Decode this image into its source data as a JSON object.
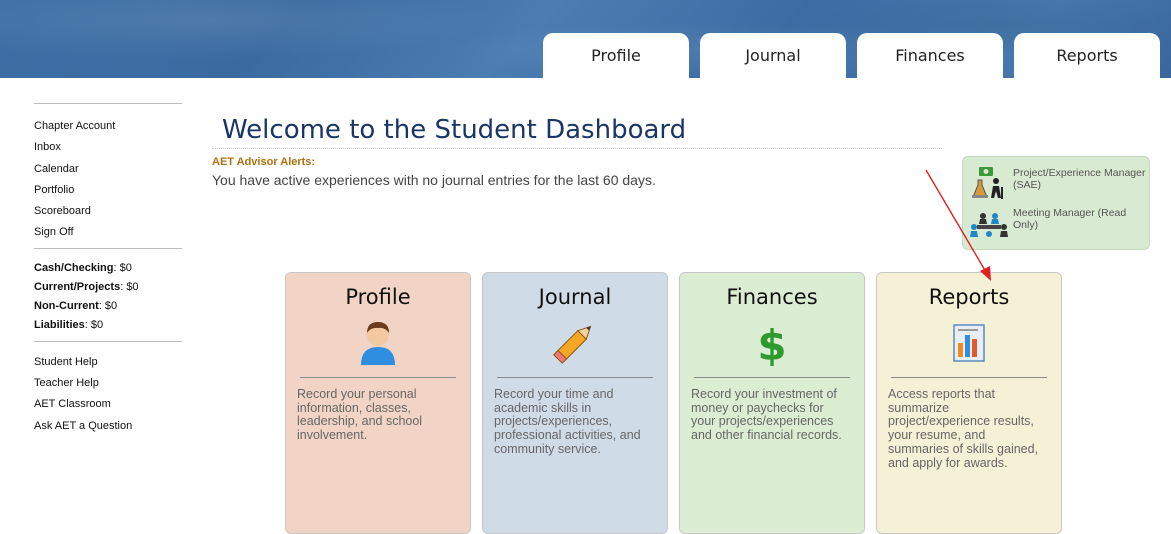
{
  "tabs": [
    {
      "label": "Profile"
    },
    {
      "label": "Journal"
    },
    {
      "label": "Finances"
    },
    {
      "label": "Reports"
    }
  ],
  "sidebar": {
    "nav": [
      "Chapter Account",
      "Inbox",
      "Calendar",
      "Portfolio",
      "Scoreboard",
      "Sign Off"
    ],
    "accounts": [
      {
        "label": "Cash/Checking",
        "value": ": $0"
      },
      {
        "label": "Current/Projects",
        "value": ": $0"
      },
      {
        "label": "Non-Current",
        "value": ": $0"
      },
      {
        "label": "Liabilities",
        "value": ": $0"
      }
    ],
    "help": [
      "Student Help",
      "Teacher Help",
      "AET Classroom",
      "Ask AET a Question"
    ]
  },
  "main": {
    "title": "Welcome to the Student Dashboard",
    "alerts_label": "AET Advisor Alerts:",
    "alert_message": "You have active experiences with no journal entries for the last 60 days."
  },
  "managers": [
    {
      "label": "Project/Experience Manager (SAE)",
      "icon": "project-manager-icon"
    },
    {
      "label": "Meeting Manager (Read Only)",
      "icon": "meeting-manager-icon"
    }
  ],
  "cards": [
    {
      "title": "Profile",
      "icon": "person-icon",
      "desc": "Record your personal information, classes, leadership, and school involvement."
    },
    {
      "title": "Journal",
      "icon": "pencil-icon",
      "desc": "Record your time and academic skills in projects/experiences, professional activities, and community service."
    },
    {
      "title": "Finances",
      "icon": "dollar-icon",
      "desc": "Record your investment of money or paychecks for your projects/experiences and other financial records."
    },
    {
      "title": "Reports",
      "icon": "report-icon",
      "desc": "Access reports that summarize project/experience results, your resume, and summaries of skills gained, and apply for awards."
    }
  ],
  "colors": {
    "header": "#3d6fa6",
    "title": "#1a3566",
    "alert_label": "#b07010",
    "profile_card": "#f2d4c6",
    "journal_card": "#d0dbe8",
    "finances_card": "#dbeed4",
    "reports_card": "#f5f1d6",
    "annotation_arrow": "#e02020"
  }
}
